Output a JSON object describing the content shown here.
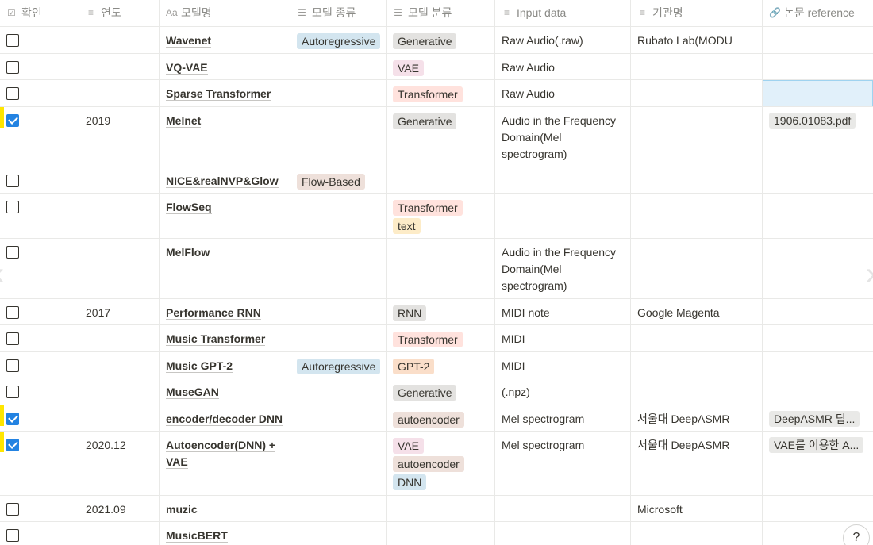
{
  "columns": [
    {
      "icon": "☑",
      "icon_name": "checkbox-icon",
      "label": "확인"
    },
    {
      "icon": "≡",
      "icon_name": "text-icon",
      "label": "연도"
    },
    {
      "icon": "Aa",
      "icon_name": "title-icon",
      "label": "모델명"
    },
    {
      "icon": "☰",
      "icon_name": "multiselect-icon",
      "label": "모델 종류"
    },
    {
      "icon": "☰",
      "icon_name": "multiselect-icon",
      "label": "모델 분류"
    },
    {
      "icon": "≡",
      "icon_name": "text-icon",
      "label": "Input data"
    },
    {
      "icon": "≡",
      "icon_name": "text-icon",
      "label": "기관명"
    },
    {
      "icon": "🔗",
      "icon_name": "attachment-icon",
      "label": "논문 reference"
    }
  ],
  "tag_colors": {
    "blue": "#d3e5ef",
    "gray": "#e3e2e0",
    "pink": "#f5e0e9",
    "red": "#ffe2dd",
    "brown": "#eee0da",
    "yellow": "#fdecc8",
    "orange": "#fadec9"
  },
  "rows": [
    {
      "checked": false,
      "year": "",
      "name": "Wavenet",
      "kind": [
        {
          "t": "Autoregressive",
          "c": "#d3e5ef"
        }
      ],
      "cls": [
        {
          "t": "Generative",
          "c": "#e3e2e0"
        }
      ],
      "input": "Raw Audio(.raw)",
      "org": "Rubato Lab(MODU Lab)",
      "ref": "",
      "h": 34
    },
    {
      "checked": false,
      "year": "",
      "name": "VQ-VAE",
      "kind": [],
      "cls": [
        {
          "t": "VAE",
          "c": "#f5e0e9"
        }
      ],
      "input": "Raw Audio",
      "org": "",
      "ref": "",
      "h": 33
    },
    {
      "checked": false,
      "year": "",
      "name": "Sparse Transformer",
      "kind": [],
      "cls": [
        {
          "t": "Transformer",
          "c": "#ffe2dd"
        }
      ],
      "input": "Raw Audio",
      "org": "",
      "ref": "",
      "h": 34,
      "selected_ref": true
    },
    {
      "checked": true,
      "year": "2019",
      "name": "Melnet",
      "kind": [],
      "cls": [
        {
          "t": "Generative",
          "c": "#e3e2e0"
        }
      ],
      "input": "Audio in the Frequency Domain(Mel spectrogram)",
      "org": "",
      "ref": "1906.01083.pdf",
      "h": 76
    },
    {
      "checked": false,
      "year": "",
      "name": "NICE&realNVP&Glow",
      "kind": [
        {
          "t": "Flow-Based",
          "c": "#eee0da"
        }
      ],
      "cls": [],
      "input": "",
      "org": "",
      "ref": "",
      "h": 33
    },
    {
      "checked": false,
      "year": "",
      "name": "FlowSeq",
      "kind": [],
      "cls": [
        {
          "t": "Transformer",
          "c": "#ffe2dd"
        },
        {
          "t": "text",
          "c": "#fdecc8"
        }
      ],
      "input": "",
      "org": "",
      "ref": "",
      "h": 57
    },
    {
      "checked": false,
      "year": "",
      "name": "MelFlow",
      "kind": [],
      "cls": [],
      "input": "Audio in the Frequency Domain(Mel spectrogram)",
      "org": "",
      "ref": "",
      "h": 76
    },
    {
      "checked": false,
      "year": "2017",
      "name": "Performance RNN",
      "kind": [],
      "cls": [
        {
          "t": "RNN",
          "c": "#e3e2e0"
        }
      ],
      "input": "MIDI note",
      "org": "Google Magenta",
      "ref": "",
      "h": 33
    },
    {
      "checked": false,
      "year": "",
      "name": "Music Transformer",
      "kind": [],
      "cls": [
        {
          "t": "Transformer",
          "c": "#ffe2dd"
        }
      ],
      "input": "MIDI",
      "org": "",
      "ref": "",
      "h": 34
    },
    {
      "checked": false,
      "year": "",
      "name": "Music GPT-2",
      "kind": [
        {
          "t": "Autoregressive",
          "c": "#d3e5ef"
        }
      ],
      "cls": [
        {
          "t": "GPT-2",
          "c": "#fadec9"
        }
      ],
      "input": "MIDI",
      "org": "",
      "ref": "",
      "h": 33
    },
    {
      "checked": false,
      "year": "",
      "name": "MuseGAN",
      "kind": [],
      "cls": [
        {
          "t": "Generative",
          "c": "#e3e2e0"
        }
      ],
      "input": "(.npz)",
      "org": "",
      "ref": "",
      "h": 34
    },
    {
      "checked": true,
      "year": "",
      "name": "encoder/decoder DNN",
      "kind": [],
      "cls": [
        {
          "t": "autoencoder",
          "c": "#eee0da"
        }
      ],
      "input": "Mel spectrogram",
      "org": "서울대 DeepASMR",
      "ref": "DeepASMR 딥...",
      "h": 33
    },
    {
      "checked": true,
      "year": "2020.12",
      "name": "Autoencoder(DNN) + VAE",
      "kind": [],
      "cls": [
        {
          "t": "VAE",
          "c": "#f5e0e9"
        },
        {
          "t": "autoencoder",
          "c": "#eee0da"
        },
        {
          "t": "DNN",
          "c": "#d3e5ef"
        }
      ],
      "input": "Mel spectrogram",
      "org": "서울대 DeepASMR",
      "ref": "VAE를 이용한 A...",
      "h": 81
    },
    {
      "checked": false,
      "year": "2021.09",
      "name": "muzic",
      "kind": [],
      "cls": [],
      "input": "",
      "org": "Microsoft",
      "ref": "",
      "h": 33
    },
    {
      "checked": false,
      "year": "",
      "name": "MusicBERT",
      "kind": [],
      "cls": [],
      "input": "",
      "org": "",
      "ref": "",
      "h": 34
    }
  ],
  "help_label": "?",
  "nav": {
    "prev": "‹",
    "next": "›"
  }
}
